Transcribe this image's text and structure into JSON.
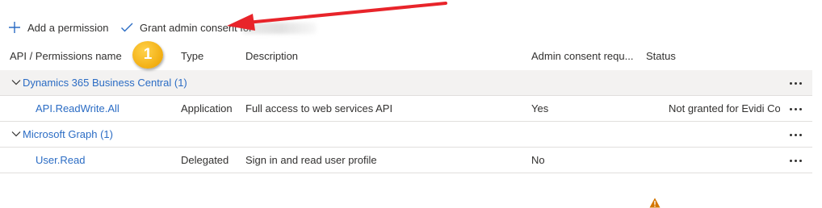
{
  "toolbar": {
    "add_permission_label": "Add a permission",
    "grant_consent_label": "Grant admin consent for"
  },
  "table": {
    "columns": [
      "API / Permissions name",
      "Type",
      "Description",
      "Admin consent requ...",
      "Status"
    ],
    "groups": [
      {
        "name": "Dynamics 365 Business Central (1)",
        "rows": [
          {
            "name": "API.ReadWrite.All",
            "type": "Application",
            "description": "Full access to web services API",
            "admin_consent": "Yes",
            "status": "Not granted for Evidi Co..."
          }
        ]
      },
      {
        "name": "Microsoft Graph (1)",
        "rows": [
          {
            "name": "User.Read",
            "type": "Delegated",
            "description": "Sign in and read user profile",
            "admin_consent": "No",
            "status": ""
          }
        ]
      }
    ]
  },
  "annotation": {
    "step_number": "1"
  },
  "colors": {
    "link": "#2b6cc4",
    "group_bg": "#f3f2f1",
    "warning": "#d47500",
    "arrow": "#e8242a",
    "badge": "#f2ae12"
  },
  "icons": {
    "add": "plus-icon",
    "grant": "checkmark-icon",
    "expand": "chevron-down-icon",
    "warning": "warning-icon",
    "more": "more-icon"
  }
}
